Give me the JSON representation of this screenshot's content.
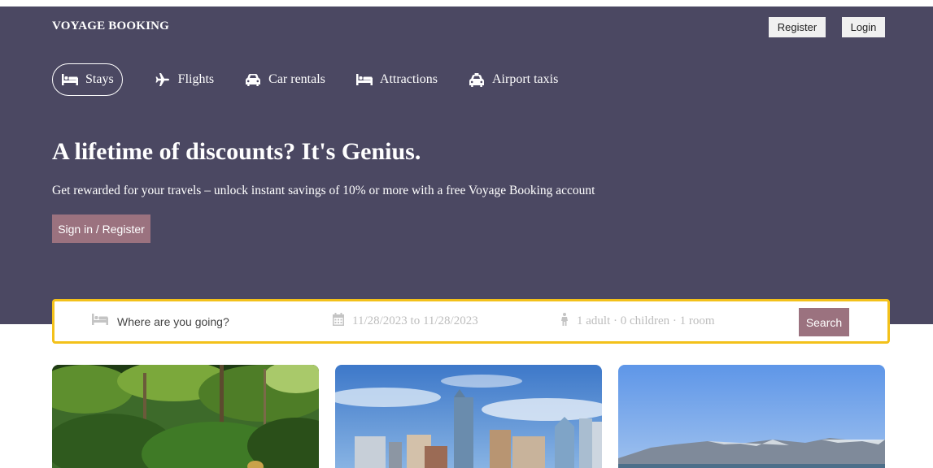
{
  "header": {
    "brand": "VOYAGE BOOKING",
    "register_label": "Register",
    "login_label": "Login"
  },
  "nav": {
    "items": [
      {
        "label": "Stays",
        "icon": "bed-icon",
        "active": true
      },
      {
        "label": "Flights",
        "icon": "plane-icon",
        "active": false
      },
      {
        "label": "Car rentals",
        "icon": "car-icon",
        "active": false
      },
      {
        "label": "Attractions",
        "icon": "bed-icon",
        "active": false
      },
      {
        "label": "Airport taxis",
        "icon": "taxi-icon",
        "active": false
      }
    ]
  },
  "hero": {
    "headline": "A lifetime of discounts? It's Genius.",
    "subline": "Get rewarded for your travels – unlock instant savings of 10% or more with a free Voyage Booking account",
    "signin_label": "Sign in / Register"
  },
  "search": {
    "destination_placeholder": "Where are you going?",
    "dates": "11/28/2023 to 11/28/2023",
    "guests": "1 adult · 0 children · 1 room",
    "button_label": "Search"
  },
  "cards": [
    {
      "image": "forest-photo"
    },
    {
      "image": "city-skyline-photo"
    },
    {
      "image": "mountain-lake-photo"
    }
  ],
  "colors": {
    "hero_bg": "#4b4862",
    "accent": "#9b727f",
    "search_border": "#f3c11a"
  }
}
